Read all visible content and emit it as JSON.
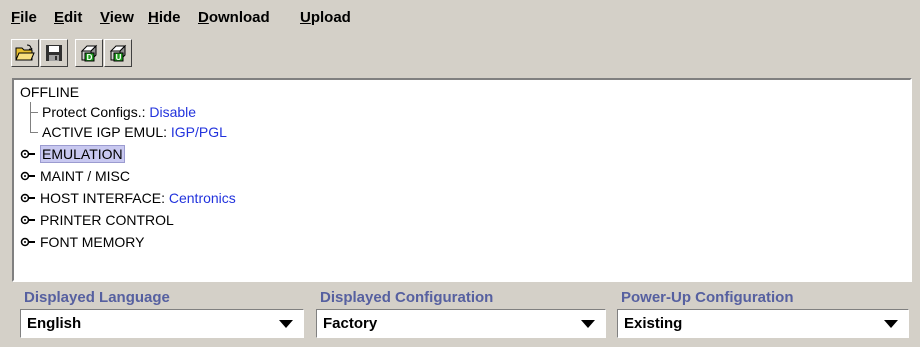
{
  "menu": [
    {
      "label": "File",
      "mnemonic": "F",
      "rest": "ile"
    },
    {
      "label": "Edit",
      "mnemonic": "E",
      "rest": "dit"
    },
    {
      "label": "View",
      "mnemonic": "V",
      "rest": "iew"
    },
    {
      "label": "Hide",
      "mnemonic": "H",
      "rest": "ide"
    },
    {
      "label": "Download",
      "mnemonic": "D",
      "rest": "ownload"
    },
    {
      "label": "Upload",
      "mnemonic": "U",
      "rest": "pload"
    }
  ],
  "toolbar": {
    "icons": [
      "open-folder-icon",
      "save-disk-icon",
      "download-printer-icon",
      "upload-printer-icon"
    ],
    "download_badge": "D",
    "upload_badge": "U"
  },
  "tree": {
    "root": "OFFLINE",
    "children": [
      {
        "label": "Protect Configs.:",
        "value": "Disable"
      },
      {
        "label": "ACTIVE IGP EMUL:",
        "value": "IGP/PGL"
      }
    ],
    "nodes": [
      {
        "label": "EMULATION",
        "value": "",
        "selected": true
      },
      {
        "label": "MAINT / MISC",
        "value": ""
      },
      {
        "label": "HOST INTERFACE:",
        "value": "Centronics"
      },
      {
        "label": "PRINTER CONTROL",
        "value": ""
      },
      {
        "label": "FONT MEMORY",
        "value": ""
      }
    ]
  },
  "bottom": {
    "language": {
      "label": "Displayed Language",
      "value": "English"
    },
    "configuration": {
      "label": "Displayed Configuration",
      "value": "Factory"
    },
    "powerup": {
      "label": "Power-Up Configuration",
      "value": "Existing"
    }
  },
  "colors": {
    "background": "#d4d0c8",
    "value_text": "#2233dd",
    "label_text": "#5660a0",
    "selection": "#c8c8f0"
  }
}
